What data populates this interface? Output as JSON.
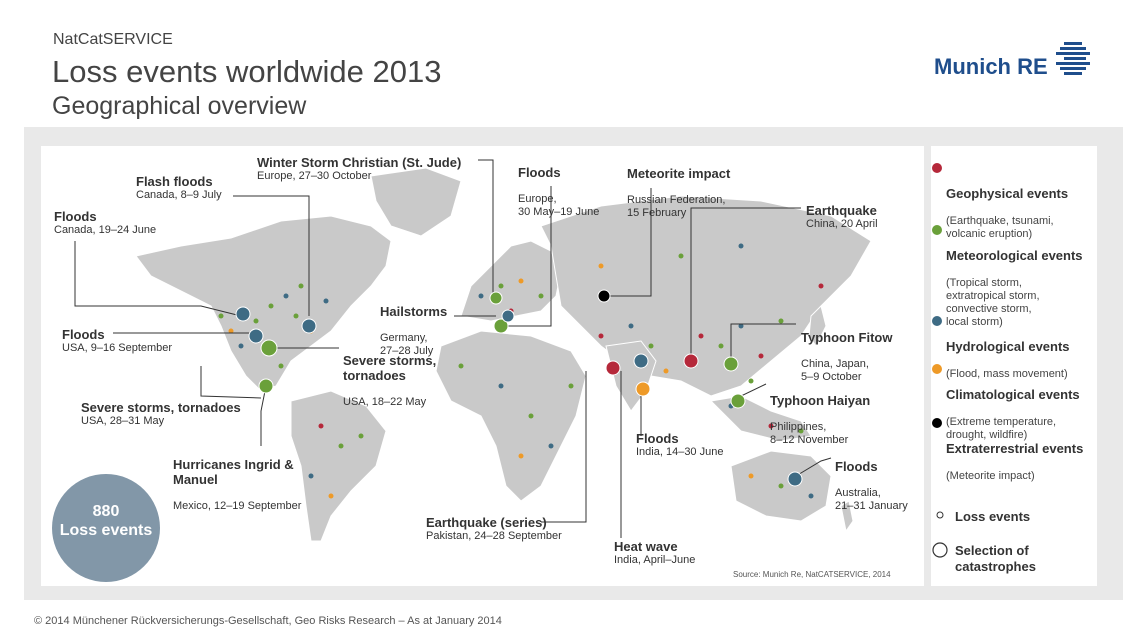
{
  "header": {
    "kicker": "NatCatSERVICE",
    "title": "Loss events worldwide 2013",
    "subtitle": "Geographical overview"
  },
  "logo": {
    "text": "Munich RE"
  },
  "annotations": [
    {
      "title": "Floods",
      "detail": "Canada, 19–24 June"
    },
    {
      "title": "Flash floods",
      "detail": "Canada, 8–9 July"
    },
    {
      "title": "Winter Storm Christian (St. Jude)",
      "detail": "Europe, 27–30 October"
    },
    {
      "title": "Floods",
      "detail": "Europe,\n30 May–19 June"
    },
    {
      "title": "Meteorite impact",
      "detail": "Russian Federation,\n15 February"
    },
    {
      "title": "Earthquake",
      "detail": "China, 20 April"
    },
    {
      "title": "Hailstorms",
      "detail": "Germany,\n27–28 July"
    },
    {
      "title": "Floods",
      "detail": "USA, 9–16 September"
    },
    {
      "title": "Severe storms,\ntornadoes",
      "detail": "USA, 18–22 May"
    },
    {
      "title": "Typhoon Fitow",
      "detail": "China, Japan,\n5–9 October"
    },
    {
      "title": "Typhoon Haiyan",
      "detail": "Philippines,\n8–12 November"
    },
    {
      "title": "Severe storms, tornadoes",
      "detail": "USA, 28–31 May"
    },
    {
      "title": "Hurricanes Ingrid &\nManuel",
      "detail": "Mexico, 12–19 September"
    },
    {
      "title": "Floods",
      "detail": "India, 14–30 June"
    },
    {
      "title": "Floods",
      "detail": "Australia,\n21–31 January"
    },
    {
      "title": "Earthquake (series)",
      "detail": "Pakistan, 24–28 September"
    },
    {
      "title": "Heat wave",
      "detail": "India, April–June"
    }
  ],
  "legend": {
    "items": [
      {
        "title": "Geophysical events",
        "detail": "(Earthquake, tsunami,\nvolcanic eruption)",
        "color": "#b5283a"
      },
      {
        "title": "Meteorological events",
        "detail": "(Tropical storm,\nextratropical storm,\nconvective storm,\nlocal storm)",
        "color": "#6aa03a"
      },
      {
        "title": "Hydrological events",
        "detail": "(Flood, mass movement)",
        "color": "#3e6b84"
      },
      {
        "title": "Climatological events",
        "detail": "(Extreme temperature,\ndrought, wildfire)",
        "color": "#ee9a28"
      },
      {
        "title": "Extraterrestrial events",
        "detail": "(Meteorite impact)",
        "color": "#000000"
      }
    ],
    "small_label": "Loss events",
    "large_label": "Selection of\ncatastrophes"
  },
  "bubble": {
    "number": "880",
    "label": "Loss events"
  },
  "source": "Source: Munich Re, NatCATSERVICE, 2014",
  "footer": "© 2014 Münchener Rückversicherungs-Gesellschaft, Geo Risks Research – As at January 2014"
}
